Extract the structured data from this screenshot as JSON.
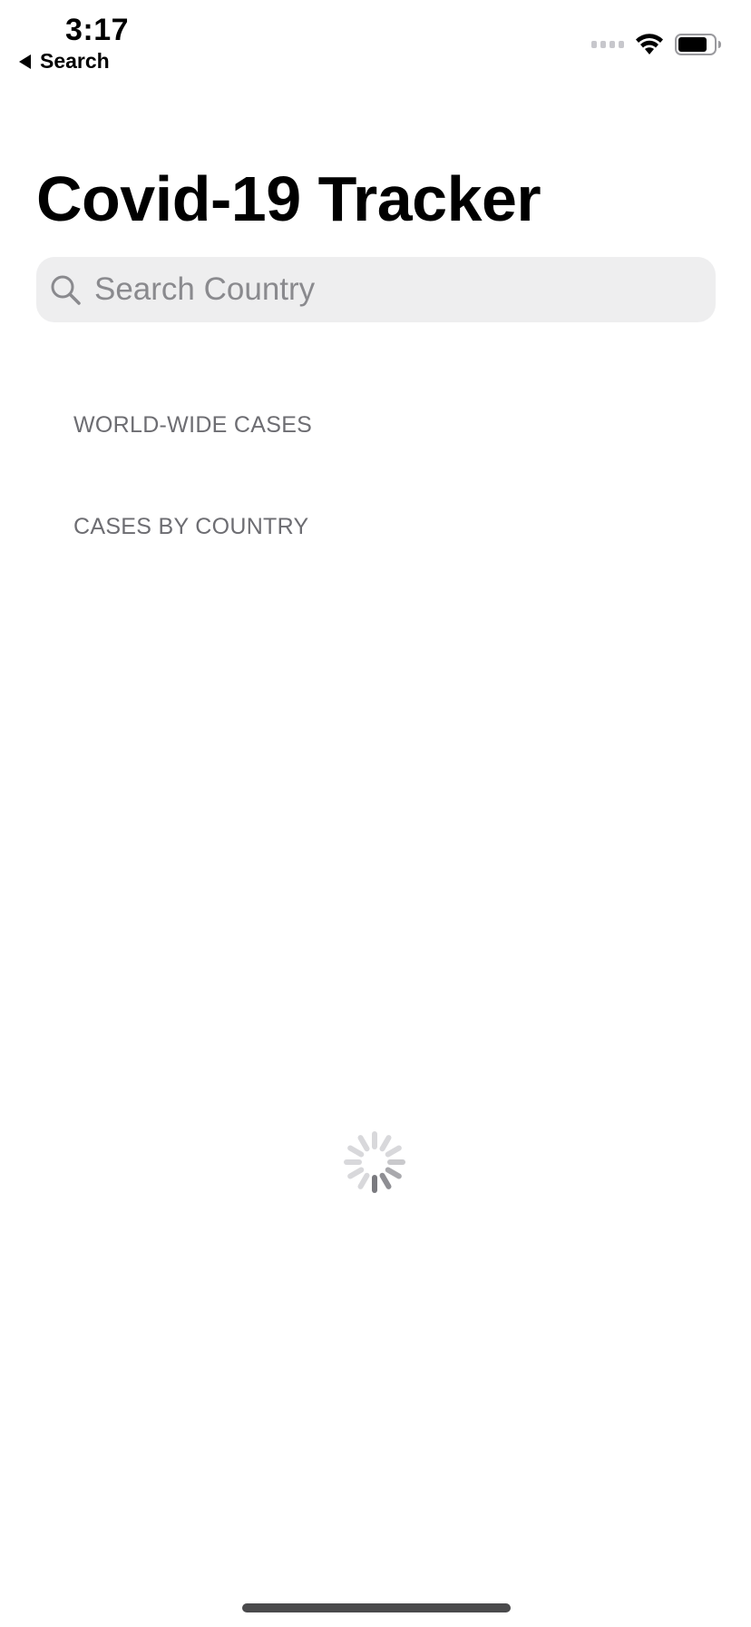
{
  "status_bar": {
    "time": "3:17",
    "back_label": "Search"
  },
  "header": {
    "title": "Covid-19 Tracker"
  },
  "search": {
    "placeholder": "Search Country",
    "value": ""
  },
  "sections": {
    "world_wide": "WORLD-WIDE CASES",
    "by_country": "CASES BY COUNTRY"
  },
  "icons": {
    "back": "back-triangle-icon",
    "signal": "cellular-signal-icon",
    "wifi": "wifi-icon",
    "battery": "battery-icon",
    "search": "search-icon",
    "spinner": "loading-spinner-icon"
  },
  "colors": {
    "search_background": "#eeeeef",
    "placeholder": "#8a8a8e",
    "section_header": "#6d6d72"
  }
}
